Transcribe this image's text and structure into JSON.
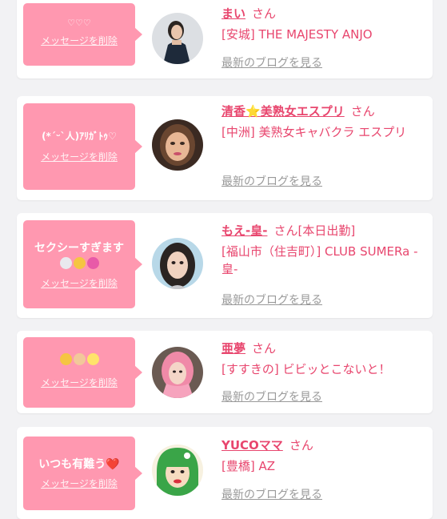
{
  "colors": {
    "accent": "#e8466e",
    "bubble": "#ff98b0",
    "muted": "#9a9a9a"
  },
  "delete_label": "メッセージを削除",
  "blog_label": "最新のブログを見る",
  "san_label": "さん",
  "cards": [
    {
      "message": "♡♡♡",
      "name": "まい",
      "shop": "[安城] THE MAJESTY ANJO"
    },
    {
      "message": "(*ˊᵕˋ人)ｱﾘｶﾞﾄｩ♡",
      "name": "清香",
      "name_emoji": "⭐",
      "name_suffix": "美熟女エスプリ",
      "shop": "[中洲] 美熟女キャバクラ エスプリ"
    },
    {
      "message": "セクシーすぎます",
      "message_emoji": "💭😱💞",
      "name": "もえ-皇-",
      "status": "[本日出勤]",
      "shop": "[福山市（住吉町）] CLUB SUMERa -皇-"
    },
    {
      "message_emoji": "😌🙏✨",
      "name": "亜夢",
      "shop": "[すすきの] ビビッとこないと！"
    },
    {
      "message": "いつも有難う❤️",
      "name": "YUCOママ",
      "shop": "[豊橋] AZ"
    }
  ]
}
